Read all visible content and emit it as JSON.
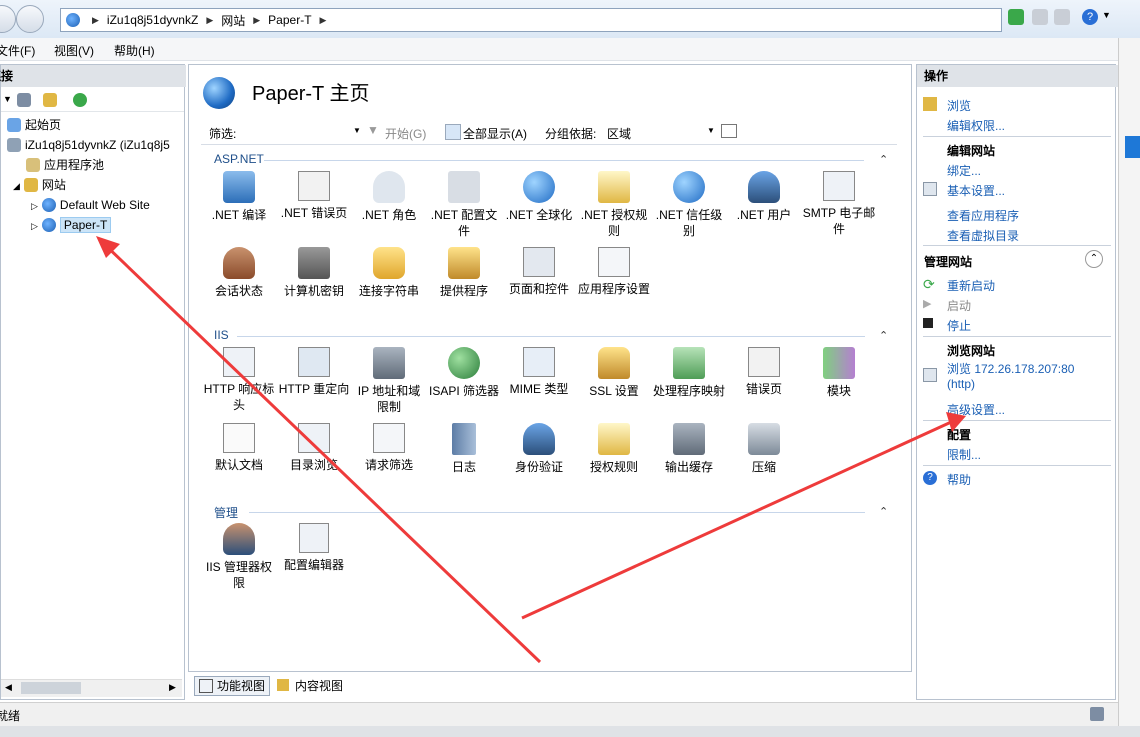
{
  "address": {
    "crumbs": [
      "iZu1q8j51dyvnkZ",
      "网站",
      "Paper-T"
    ]
  },
  "menu": [
    "文件(F)",
    "视图(V)",
    "帮助(H)"
  ],
  "left": {
    "header": "连接",
    "tree": [
      {
        "label": "起始页"
      },
      {
        "label": "iZu1q8j51dyvnkZ (iZu1q8j5"
      },
      {
        "label": "应用程序池"
      },
      {
        "label": "网站"
      },
      {
        "label": "Default Web Site"
      },
      {
        "label": "Paper-T"
      }
    ]
  },
  "center": {
    "title": "Paper-T 主页",
    "filter": {
      "label": "筛选:",
      "start": "开始(G)",
      "showall": "全部显示(A)",
      "groupby_label": "分组依据:",
      "groupby_value": "区域"
    },
    "sections": {
      "aspnet": {
        "title": "ASP.NET",
        "items": [
          ".NET 编译",
          ".NET 错误页",
          ".NET 角色",
          ".NET 配置文件",
          ".NET 全球化",
          ".NET 授权规则",
          ".NET 信任级别",
          ".NET 用户",
          "SMTP 电子邮件",
          "会话状态",
          "计算机密钥",
          "连接字符串",
          "提供程序",
          "页面和控件",
          "应用程序设置"
        ]
      },
      "iis": {
        "title": "IIS",
        "items": [
          "HTTP 响应标头",
          "HTTP 重定向",
          "IP 地址和域限制",
          "ISAPI 筛选器",
          "MIME 类型",
          "SSL 设置",
          "处理程序映射",
          "错误页",
          "模块",
          "默认文档",
          "目录浏览",
          "请求筛选",
          "日志",
          "身份验证",
          "授权规则",
          "输出缓存",
          "压缩"
        ]
      },
      "manage": {
        "title": "管理",
        "items": [
          "IIS 管理器权限",
          "配置编辑器"
        ]
      }
    },
    "tabs": {
      "features": "功能视图",
      "content": "内容视图"
    }
  },
  "right": {
    "header": "操作",
    "browse": "浏览",
    "edit_perms": "编辑权限...",
    "edit_site_h": "编辑网站",
    "bindings": "绑定...",
    "basic_settings": "基本设置...",
    "view_apps": "查看应用程序",
    "view_vdirs": "查看虚拟目录",
    "manage_site_h": "管理网站",
    "restart": "重新启动",
    "start": "启动",
    "stop": "停止",
    "browse_site_h": "浏览网站",
    "browse_url_1": "浏览 172.26.178.207:80",
    "browse_url_2": "(http)",
    "advanced": "高级设置...",
    "config_h": "配置",
    "limits": "限制...",
    "help": "帮助"
  },
  "status": {
    "text": "就绪"
  },
  "colors": {
    "accent": "#1a5fb4",
    "arrow": "#ee3b3b"
  }
}
